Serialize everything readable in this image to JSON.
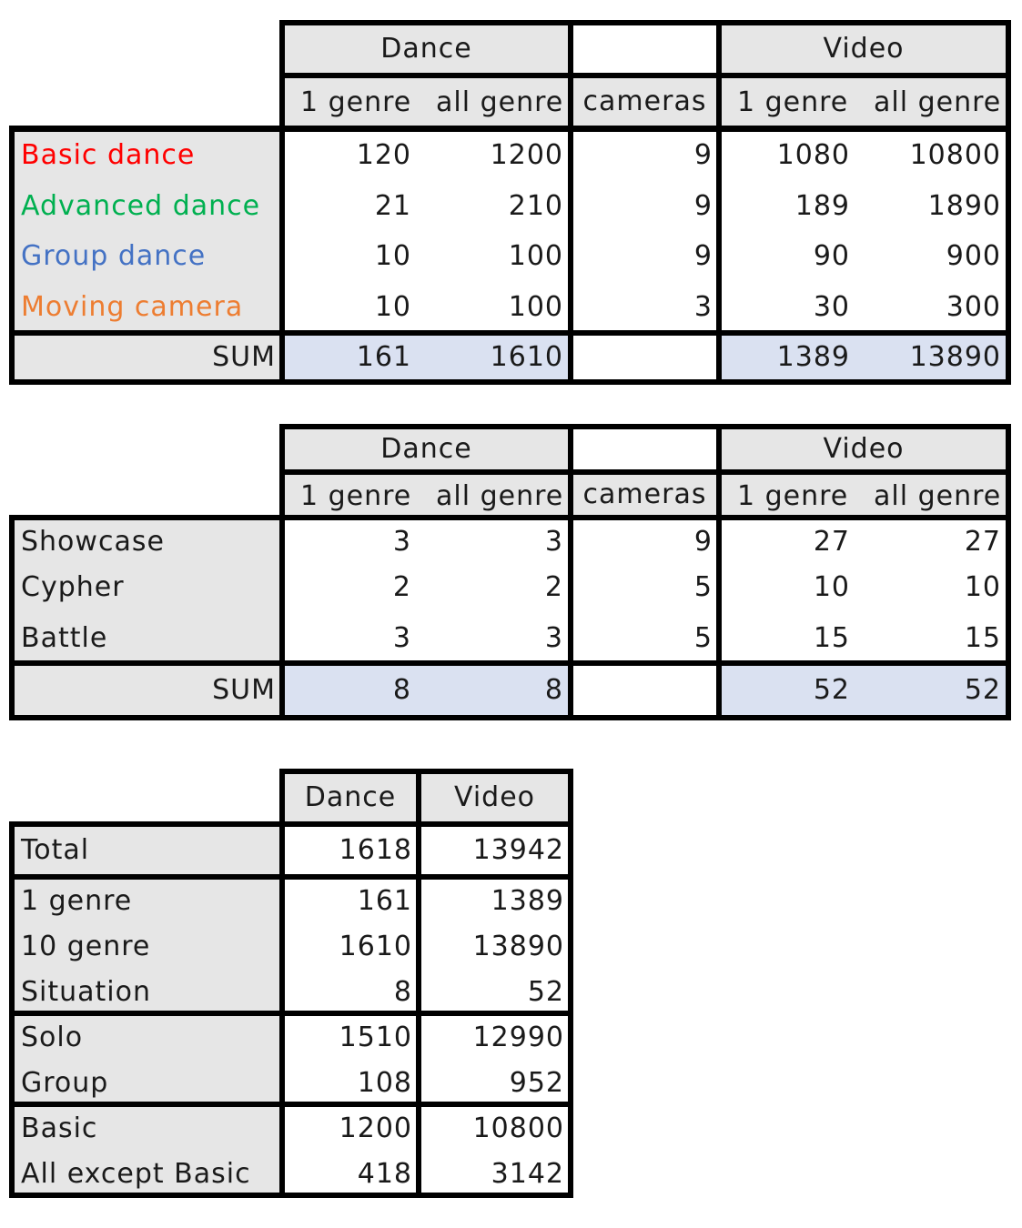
{
  "table1": {
    "headers": {
      "dance": "Dance",
      "video": "Video",
      "d1": "1 genre",
      "dall": "all genre",
      "cameras": "cameras",
      "v1": "1 genre",
      "vall": "all genre"
    },
    "rows": [
      {
        "label": "Basic dance",
        "d1": "120",
        "dall": "1200",
        "cam": "9",
        "v1": "1080",
        "vall": "10800"
      },
      {
        "label": "Advanced dance",
        "d1": "21",
        "dall": "210",
        "cam": "9",
        "v1": "189",
        "vall": "1890"
      },
      {
        "label": "Group dance",
        "d1": "10",
        "dall": "100",
        "cam": "9",
        "v1": "90",
        "vall": "900"
      },
      {
        "label": "Moving camera",
        "d1": "10",
        "dall": "100",
        "cam": "3",
        "v1": "30",
        "vall": "300"
      }
    ],
    "row_colors": [
      "#ff0000",
      "#00b050",
      "#4472c4",
      "#ed7d31"
    ],
    "sum": {
      "label": "SUM",
      "d1": "161",
      "dall": "1610",
      "v1": "1389",
      "vall": "13890"
    }
  },
  "table2": {
    "headers": {
      "dance": "Dance",
      "video": "Video",
      "d1": "1 genre",
      "dall": "all genre",
      "cameras": "cameras",
      "v1": "1 genre",
      "vall": "all genre"
    },
    "rows": [
      {
        "label": "Showcase",
        "d1": "3",
        "dall": "3",
        "cam": "9",
        "v1": "27",
        "vall": "27"
      },
      {
        "label": "Cypher",
        "d1": "2",
        "dall": "2",
        "cam": "5",
        "v1": "10",
        "vall": "10"
      },
      {
        "label": "Battle",
        "d1": "3",
        "dall": "3",
        "cam": "5",
        "v1": "15",
        "vall": "15"
      }
    ],
    "sum": {
      "label": "SUM",
      "d1": "8",
      "dall": "8",
      "v1": "52",
      "vall": "52"
    }
  },
  "table3": {
    "headers": {
      "dance": "Dance",
      "video": "Video"
    },
    "total": {
      "label": "Total",
      "dance": "1618",
      "video": "13942"
    },
    "genre_rows": [
      {
        "label": "1 genre",
        "dance": "161",
        "video": "1389"
      },
      {
        "label": "10 genre",
        "dance": "1610",
        "video": "13890"
      },
      {
        "label": "Situation",
        "dance": "8",
        "video": "52"
      }
    ],
    "type_rows": [
      {
        "label": "Solo",
        "dance": "1510",
        "video": "12990"
      },
      {
        "label": "Group",
        "dance": "108",
        "video": "952"
      }
    ],
    "basic_rows": [
      {
        "label": "Basic",
        "dance": "1200",
        "video": "10800"
      },
      {
        "label": "All except Basic",
        "dance": "418",
        "video": "3142"
      }
    ]
  }
}
